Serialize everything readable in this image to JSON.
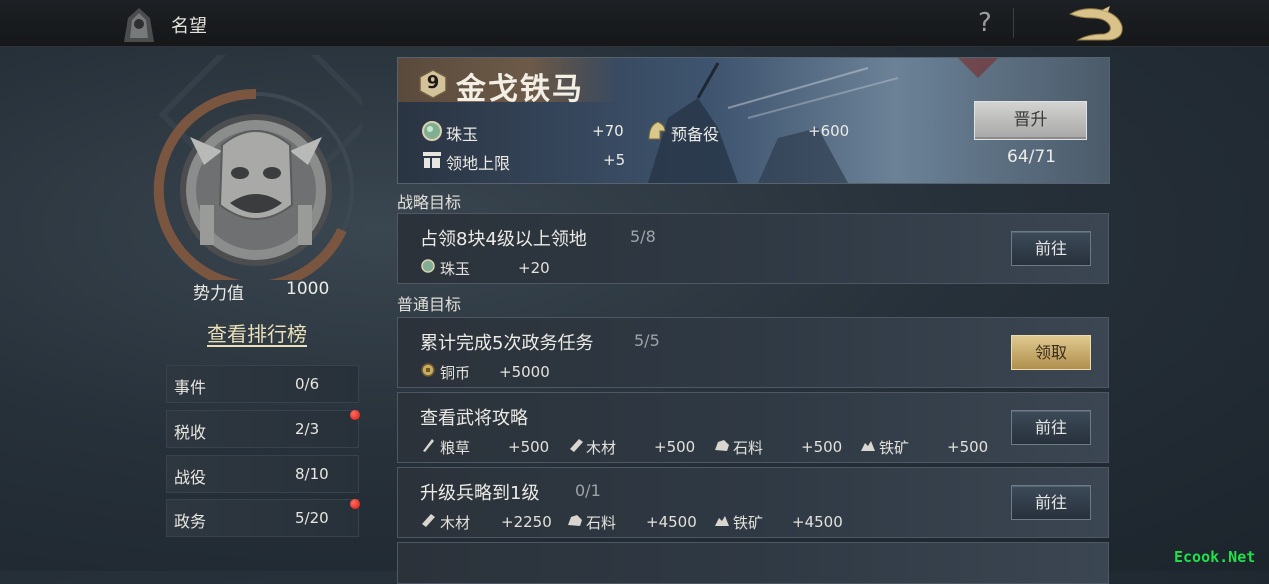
{
  "header": {
    "title": "名望",
    "help": "?"
  },
  "profile": {
    "power_label": "势力值",
    "power_value": "1000",
    "ranking_link": "查看排行榜",
    "stats": [
      {
        "label": "事件",
        "value": "0/6",
        "alert": false
      },
      {
        "label": "税收",
        "value": "2/3",
        "alert": true
      },
      {
        "label": "战役",
        "value": "8/10",
        "alert": false
      },
      {
        "label": "政务",
        "value": "5/20",
        "alert": true
      }
    ]
  },
  "rank": {
    "level": "9",
    "title": "金戈铁马",
    "rewards": [
      {
        "label": "珠玉",
        "value": "+70",
        "icon": "jade-icon"
      },
      {
        "label": "预备役",
        "value": "+600",
        "icon": "reserve-helmet-icon"
      },
      {
        "label": "领地上限",
        "value": "+5",
        "icon": "territory-icon"
      }
    ],
    "promote_label": "晋升",
    "progress": "64/71"
  },
  "sections": {
    "strategic": "战略目标",
    "normal": "普通目标"
  },
  "tasks": [
    {
      "name": "占领8块4级以上领地",
      "progress": "5/8",
      "button": "前往",
      "rewards": [
        {
          "label": "珠玉",
          "value": "+20",
          "icon": "jade-icon"
        }
      ]
    },
    {
      "name": "累计完成5次政务任务",
      "progress": "5/5",
      "button": "领取",
      "rewards": [
        {
          "label": "铜币",
          "value": "+5000",
          "icon": "coin-icon"
        }
      ]
    },
    {
      "name": "查看武将攻略",
      "progress": "",
      "button": "前往",
      "rewards": [
        {
          "label": "粮草",
          "value": "+500",
          "icon": "grain-icon"
        },
        {
          "label": "木材",
          "value": "+500",
          "icon": "wood-icon"
        },
        {
          "label": "石料",
          "value": "+500",
          "icon": "stone-icon"
        },
        {
          "label": "铁矿",
          "value": "+500",
          "icon": "iron-icon"
        }
      ]
    },
    {
      "name": "升级兵略到1级",
      "progress": "0/1",
      "button": "前往",
      "rewards": [
        {
          "label": "木材",
          "value": "+2250",
          "icon": "wood-icon"
        },
        {
          "label": "石料",
          "value": "+4500",
          "icon": "stone-icon"
        },
        {
          "label": "铁矿",
          "value": "+4500",
          "icon": "iron-icon"
        }
      ]
    }
  ],
  "watermark": "Ecook.Net"
}
